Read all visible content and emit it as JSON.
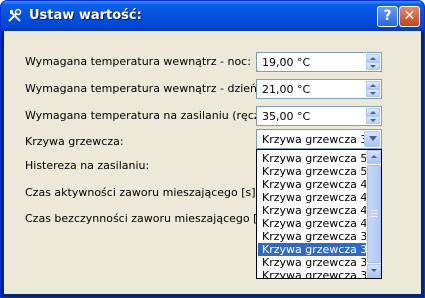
{
  "window": {
    "title": "Ustaw wartość:",
    "help_label": "?",
    "close_label": "✕"
  },
  "fields": [
    {
      "label": "Wymagana temperatura wewnątrz - noc:",
      "value": "19,00 °C"
    },
    {
      "label": "Wymagana temperatura wewnątrz - dzień:",
      "value": "21,00 °C"
    },
    {
      "label": "Wymagana temperatura na zasilaniu (ręczny):",
      "value": "35,00 °C"
    }
  ],
  "curve": {
    "label": "Krzywa grzewcza:",
    "selected": "Krzywa grzewcza 35",
    "options": [
      "Krzywa grzewcza 55",
      "Krzywa grzewcza 51",
      "Krzywa grzewcza 48",
      "Krzywa grzewcza 45",
      "Krzywa grzewcza 43",
      "Krzywa grzewcza 41",
      "Krzywa grzewcza 38",
      "Krzywa grzewcza 35",
      "Krzywa grzewcza 33",
      "Krzywa grzewcza 31"
    ]
  },
  "other_labels": {
    "hysteresis": "Histereza na zasilaniu:",
    "valve_active": "Czas aktywności zaworu mieszającego [s]:",
    "valve_inactive": "Czas bezczynności zaworu mieszającego [s]:"
  }
}
